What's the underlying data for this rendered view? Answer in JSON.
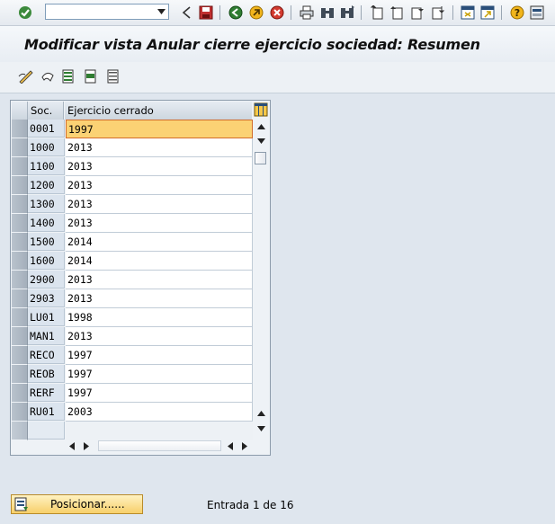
{
  "command_field": {
    "value": ""
  },
  "title": "Modificar vista Anular cierre ejercicio sociedad: Resumen",
  "table": {
    "headers": {
      "company": "Soc.",
      "fiscal_year": "Ejercicio cerrado"
    },
    "rows": [
      {
        "soc": "0001",
        "year": "1997",
        "selected": true
      },
      {
        "soc": "1000",
        "year": "2013"
      },
      {
        "soc": "1100",
        "year": "2013"
      },
      {
        "soc": "1200",
        "year": "2013"
      },
      {
        "soc": "1300",
        "year": "2013"
      },
      {
        "soc": "1400",
        "year": "2013"
      },
      {
        "soc": "1500",
        "year": "2014"
      },
      {
        "soc": "1600",
        "year": "2014"
      },
      {
        "soc": "2900",
        "year": "2013"
      },
      {
        "soc": "2903",
        "year": "2013"
      },
      {
        "soc": "LU01",
        "year": "1998"
      },
      {
        "soc": "MAN1",
        "year": "2013"
      },
      {
        "soc": "RECO",
        "year": "1997"
      },
      {
        "soc": "REOB",
        "year": "1997"
      },
      {
        "soc": "RERF",
        "year": "1997"
      },
      {
        "soc": "RU01",
        "year": "2003"
      }
    ]
  },
  "footer": {
    "position_button": "Posicionar......",
    "entry_info": "Entrada 1 de 16"
  },
  "colors": {
    "selected_cell": "#fbd274",
    "position_button": "#f7cf6a",
    "background": "#dfe6ee"
  },
  "icons": {
    "toolbar": [
      "check-icon",
      "back-icon",
      "save-icon",
      "back-green-icon",
      "exit-icon",
      "cancel-icon",
      "print-icon",
      "find-icon",
      "find-next-icon",
      "first-page-icon",
      "previous-page-icon",
      "next-page-icon",
      "last-page-icon",
      "new-session-icon",
      "shortcut-icon",
      "help-icon",
      "layout-icon"
    ],
    "app_toolbar": [
      "edit-toggle-icon",
      "undo-icon",
      "select-all-icon",
      "select-block-icon",
      "deselect-all-icon"
    ]
  }
}
